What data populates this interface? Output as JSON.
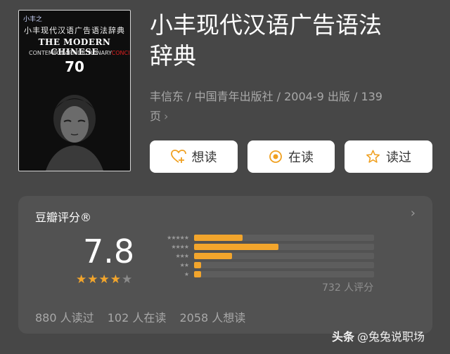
{
  "cover": {
    "series": "小丰之",
    "title_cn": "小丰现代汉语广告语法辞典",
    "title_en": "THE MODERN CHINESE",
    "subtitle": "CONTEMPORARY·DICTIONARY",
    "subtitle_red": "CONCISE",
    "number": "70"
  },
  "book": {
    "title_line1": "小丰现代汉语广告语法",
    "title_line2": "辞典",
    "meta_line1": "丰信东 / 中国青年出版社 / 2004-9 出版 / 139",
    "meta_line2": "页"
  },
  "actions": {
    "want": "想读",
    "reading": "在读",
    "read": "读过"
  },
  "rating": {
    "title": "豆瓣评分®",
    "score": "7.8",
    "star_level": 4,
    "star_max": 5,
    "distribution": [
      {
        "stars": 5,
        "fraction": 0.27
      },
      {
        "stars": 4,
        "fraction": 0.47
      },
      {
        "stars": 3,
        "fraction": 0.21
      },
      {
        "stars": 2,
        "fraction": 0.04
      },
      {
        "stars": 1,
        "fraction": 0.04
      }
    ],
    "count": "732 人评分",
    "read": "880 人读过",
    "reading": "102 人在读",
    "want": "2058 人想读"
  },
  "watermark": {
    "brand": "头条",
    "handle": "@兔兔说职场"
  },
  "colors": {
    "background": "#474747",
    "card": "#525252",
    "accent": "#f2a52c",
    "button_icon": "#f0a020"
  }
}
